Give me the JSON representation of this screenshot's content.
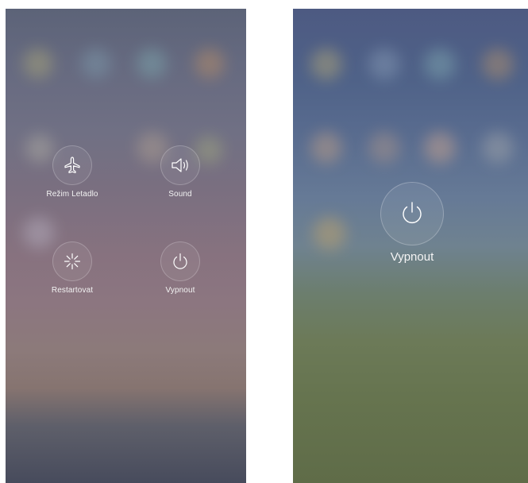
{
  "left_screen": {
    "airplane": {
      "label": "Režim Letadlo",
      "icon": "airplane-icon"
    },
    "sound": {
      "label": "Sound",
      "icon": "speaker-icon"
    },
    "restart": {
      "label": "Restartovat",
      "icon": "restart-icon"
    },
    "power_off": {
      "label": "Vypnout",
      "icon": "power-icon"
    }
  },
  "right_screen": {
    "power_off": {
      "label": "Vypnout",
      "icon": "power-icon"
    }
  }
}
